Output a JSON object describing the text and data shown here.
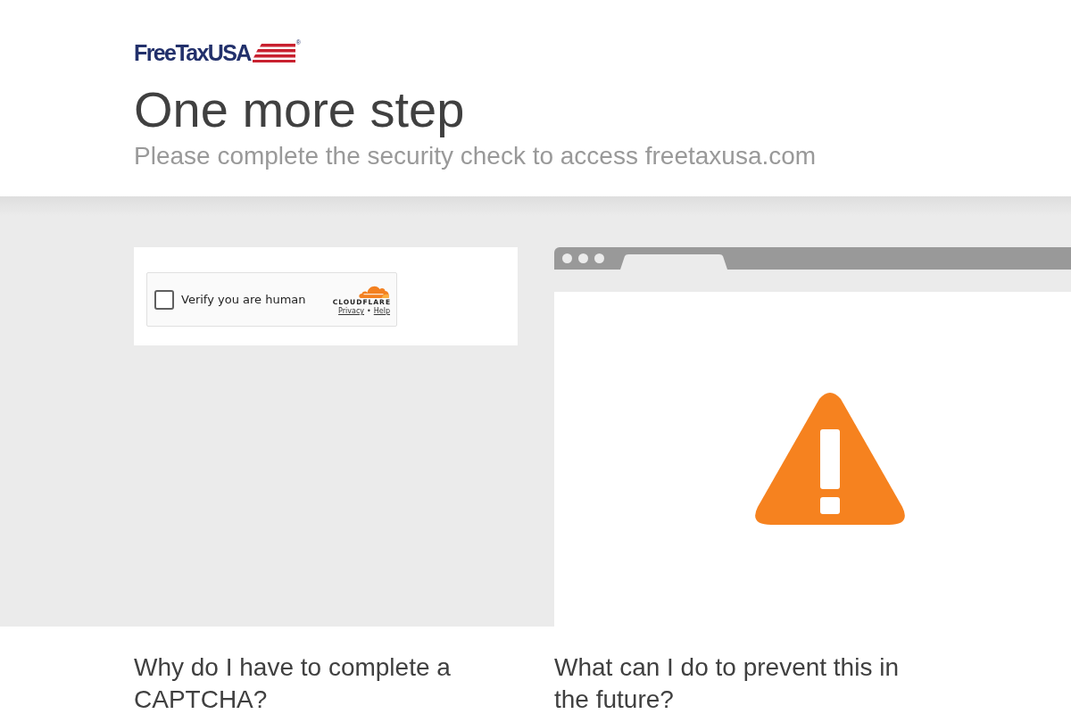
{
  "logo": {
    "wordmark": "FreeTaxUSA",
    "registered": "®"
  },
  "heading": {
    "title": "One more step",
    "subtitle": "Please complete the security check to access freetaxusa.com"
  },
  "challenge": {
    "checkbox": {
      "label": "Verify you are human",
      "checked": false
    },
    "brand": "CLOUDFLARE",
    "links": [
      "Privacy",
      "Help"
    ],
    "separator": "•"
  },
  "faq": [
    {
      "question": "Why do I have to complete a CAPTCHA?"
    },
    {
      "question": "What can I do to prevent this in the future?"
    }
  ]
}
